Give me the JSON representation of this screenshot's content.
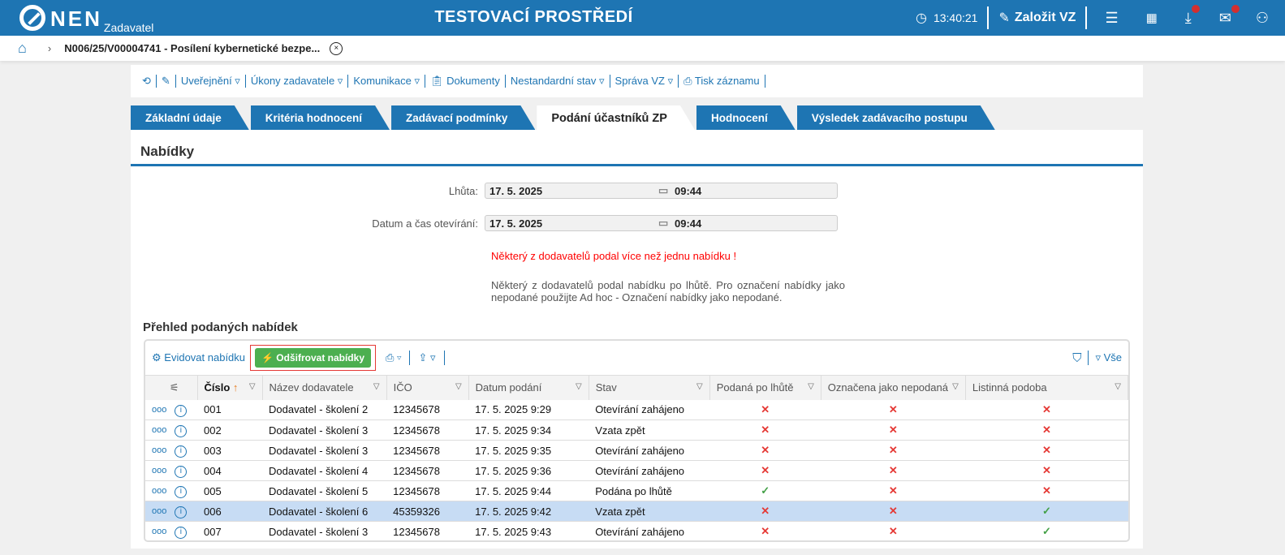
{
  "header": {
    "logo": "NEN",
    "logo_sub": "Zadavatel",
    "title": "TESTOVACÍ PROSTŘEDÍ",
    "time": "13:40:21",
    "create_label": "Založit VZ"
  },
  "breadcrumb": {
    "item": "N006/25/V00004741 - Posílení kybernetické bezpe..."
  },
  "toolbar": {
    "items": [
      "Uveřejnění ▿",
      "Úkony zadavatele ▿",
      "Komunikace ▿",
      "Dokumenty",
      "Nestandardní stav ▿",
      "Správa VZ ▿",
      "Tisk záznamu"
    ]
  },
  "tabs": [
    "Základní údaje",
    "Kritéria hodnocení",
    "Zadávací podmínky",
    "Podání účastníků ZP",
    "Hodnocení",
    "Výsledek zadávacího postupu"
  ],
  "active_tab": 3,
  "section": {
    "title": "Nabídky"
  },
  "form": {
    "lhuta_label": "Lhůta:",
    "lhuta_date": "17. 5. 2025",
    "lhuta_time": "09:44",
    "open_label": "Datum a čas otevírání:",
    "open_date": "17. 5. 2025",
    "open_time": "09:44"
  },
  "warning": "Některý z dodavatelů podal více než jednu nabídku !",
  "note": "Některý z dodavatelů podal nabídku po lhůtě. Pro označení nabídky jako nepodané použijte Ad hoc - Označení nabídky jako nepodané.",
  "offers": {
    "title": "Přehled podaných nabídek",
    "register_label": "Evidovat nabídku",
    "decrypt_label": "Odšifrovat nabídky",
    "filter_all": "▿ Vše",
    "columns": [
      "Číslo",
      "Název dodavatele",
      "IČO",
      "Datum podání",
      "Stav",
      "Podaná po lhůtě",
      "Označena jako nepodaná",
      "Listinná podoba"
    ],
    "rows": [
      {
        "num": "001",
        "name": "Dodavatel - školení 2",
        "ico": "12345678",
        "date": "17. 5. 2025 9:29",
        "state": "Otevírání zahájeno",
        "late": false,
        "nonsub": false,
        "paper": false
      },
      {
        "num": "002",
        "name": "Dodavatel - školení 3",
        "ico": "12345678",
        "date": "17. 5. 2025 9:34",
        "state": "Vzata zpět",
        "late": false,
        "nonsub": false,
        "paper": false
      },
      {
        "num": "003",
        "name": "Dodavatel - školení 3",
        "ico": "12345678",
        "date": "17. 5. 2025 9:35",
        "state": "Otevírání zahájeno",
        "late": false,
        "nonsub": false,
        "paper": false
      },
      {
        "num": "004",
        "name": "Dodavatel - školení 4",
        "ico": "12345678",
        "date": "17. 5. 2025 9:36",
        "state": "Otevírání zahájeno",
        "late": false,
        "nonsub": false,
        "paper": false
      },
      {
        "num": "005",
        "name": "Dodavatel - školení 5",
        "ico": "12345678",
        "date": "17. 5. 2025 9:44",
        "state": "Podána po lhůtě",
        "late": true,
        "nonsub": false,
        "paper": false
      },
      {
        "num": "006",
        "name": "Dodavatel - školení 6",
        "ico": "45359326",
        "date": "17. 5. 2025 9:42",
        "state": "Vzata zpět",
        "late": false,
        "nonsub": false,
        "paper": true,
        "selected": true
      },
      {
        "num": "007",
        "name": "Dodavatel - školení 3",
        "ico": "12345678",
        "date": "17. 5. 2025 9:43",
        "state": "Otevírání zahájeno",
        "late": false,
        "nonsub": false,
        "paper": true
      }
    ]
  },
  "colors": {
    "brand": "#1e75b3",
    "decrypt": "#4caf50",
    "warning": "#ff0000",
    "selected_row": "#c7dcf4"
  }
}
